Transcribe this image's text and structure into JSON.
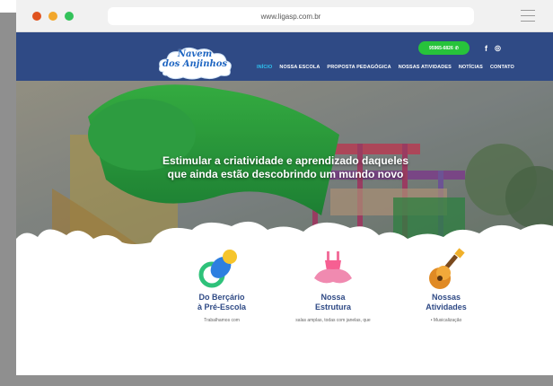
{
  "browser": {
    "url": "www.ligasp.com.br"
  },
  "header": {
    "logo_line1": "Navem",
    "logo_line2": "dos Anjinhos",
    "phone": "95965-6826",
    "social": {
      "facebook": "f",
      "instagram": "◎"
    },
    "nav": [
      {
        "label": "INÍCIO",
        "active": true
      },
      {
        "label": "NOSSA ESCOLA"
      },
      {
        "label": "PROPOSTA PEDAGÓGICA"
      },
      {
        "label": "NOSSAS ATIVIDADES"
      },
      {
        "label": "NOTÍCIAS"
      },
      {
        "label": "CONTATO"
      }
    ]
  },
  "hero": {
    "headline_line1": "Estimular a criatividade e aprendizado daqueles",
    "headline_line2": "que ainda estão descobrindo um mundo novo"
  },
  "features": [
    {
      "title_line1": "Do Berçário",
      "title_line2": "à Pré-Escola",
      "text": "Trabalhamos com",
      "icon": "pacifier-icon"
    },
    {
      "title_line1": "Nossa",
      "title_line2": "Estrutura",
      "text": "salas amplas, todas com janelas, que",
      "icon": "tutu-icon"
    },
    {
      "title_line1": "Nossas",
      "title_line2": "Atividades",
      "text": "• Musicalização",
      "icon": "guitar-icon"
    }
  ],
  "colors": {
    "navbar": "#2f4a85",
    "active_nav": "#2ec2f0",
    "phone_button": "#27c33b",
    "feature_title": "#2f4a85"
  }
}
